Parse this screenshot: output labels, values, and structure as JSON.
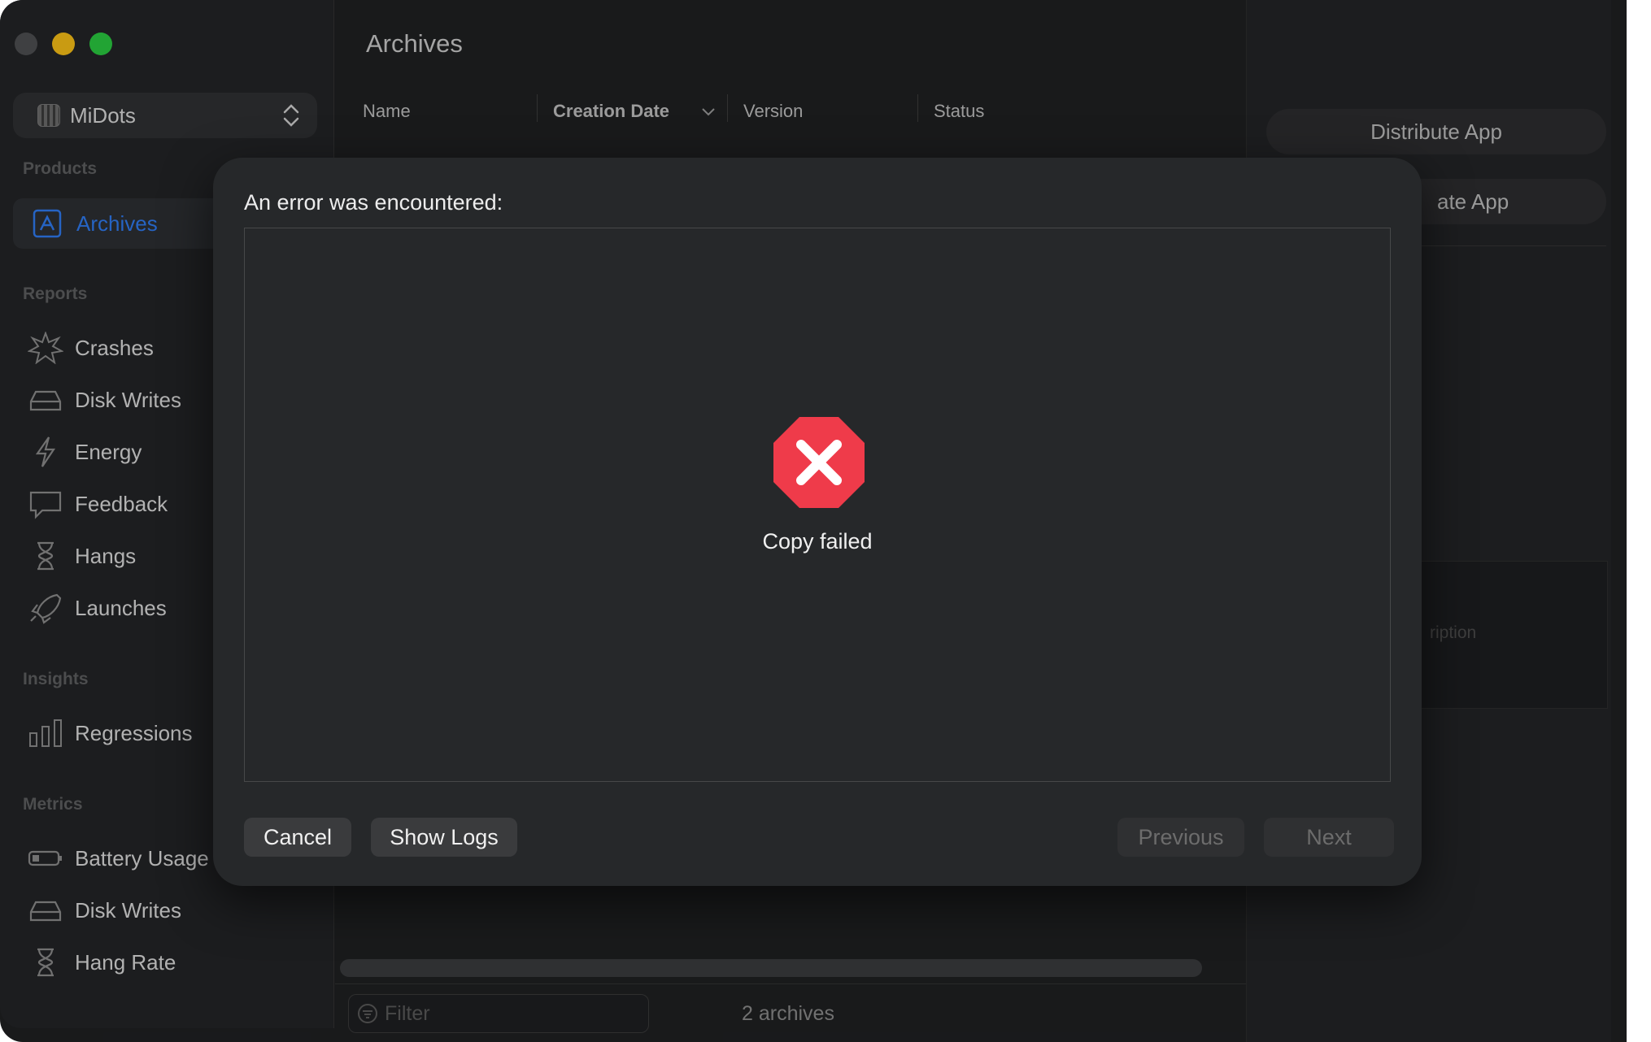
{
  "sidebar": {
    "scheme_label": "MiDots",
    "sections": {
      "products": "Products",
      "reports": "Reports",
      "insights": "Insights",
      "metrics": "Metrics"
    },
    "items": {
      "archives": "Archives",
      "crashes": "Crashes",
      "disk_writes": "Disk Writes",
      "energy": "Energy",
      "feedback": "Feedback",
      "hangs": "Hangs",
      "launches": "Launches",
      "regressions": "Regressions",
      "battery_usage": "Battery Usage",
      "disk_writes_metric": "Disk Writes",
      "hang_rate": "Hang Rate"
    }
  },
  "main": {
    "title": "Archives",
    "columns": [
      "Name",
      "Creation Date",
      "Version",
      "Status"
    ],
    "filter_placeholder": "Filter",
    "archive_count": "2 archives"
  },
  "right_panel": {
    "distribute_label": "Distribute App",
    "validate_label": "ate App",
    "description_label": "ription"
  },
  "sheet": {
    "title": "An error was encountered:",
    "error_message": "Copy failed",
    "cancel_label": "Cancel",
    "show_logs_label": "Show Logs",
    "previous_label": "Previous",
    "next_label": "Next"
  },
  "colors": {
    "accent": "#2f7bf0",
    "error": "#ef3b4a",
    "yellow": "#f6bd16",
    "green": "#2ac840"
  }
}
